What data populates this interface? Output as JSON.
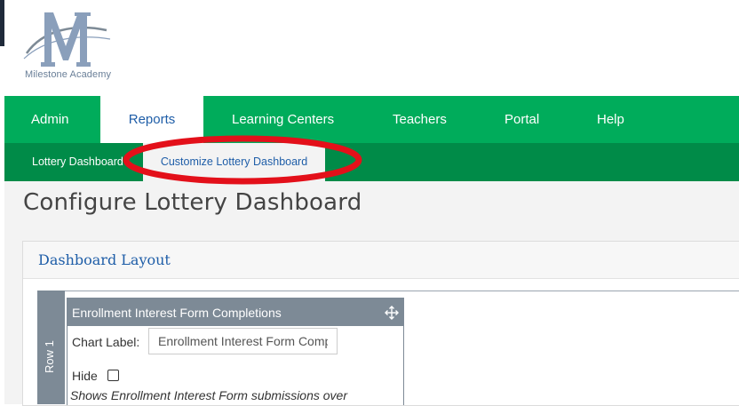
{
  "brand": {
    "name": "Milestone Academy",
    "logo_icon": "milestone-m-logo-icon",
    "logo_color": "#8a9fbb"
  },
  "nav": {
    "items": [
      {
        "label": "Admin",
        "active": false
      },
      {
        "label": "Reports",
        "active": true
      },
      {
        "label": "Learning Centers",
        "active": false
      },
      {
        "label": "Teachers",
        "active": false
      },
      {
        "label": "Portal",
        "active": false
      },
      {
        "label": "Help",
        "active": false
      }
    ],
    "color": "#00ac5b"
  },
  "subnav": {
    "items": [
      {
        "label": "Lottery Dashboard",
        "active": false
      },
      {
        "label": "Customize Lottery Dashboard",
        "active": true
      }
    ],
    "color": "#008b48"
  },
  "page": {
    "title": "Configure Lottery Dashboard"
  },
  "panel": {
    "title": "Dashboard Layout"
  },
  "layout": {
    "row_label": "Row 1",
    "widget": {
      "title": "Enrollment Interest Form Completions",
      "chart_label_text": "Chart Label:",
      "chart_label_value": "Enrollment Interest Form Completions",
      "hide_label": "Hide",
      "hide_checked": false,
      "description": "Shows Enrollment Interest Form submissions over",
      "move_icon": "move-arrows-icon"
    }
  },
  "annotation": {
    "shape": "ellipse",
    "color": "#e3101a",
    "target": "Customize Lottery Dashboard"
  }
}
